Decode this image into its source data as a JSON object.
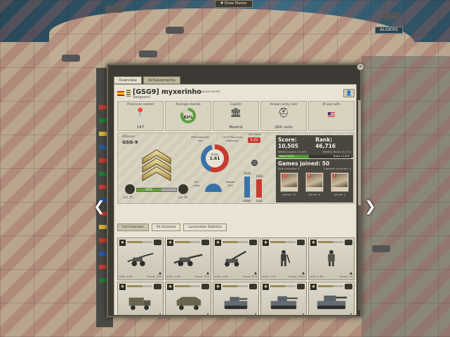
{
  "map": {
    "show_marker_label": "▼ Show Marker",
    "city_label": "ALGIERS"
  },
  "dialog": {
    "tabs": [
      "Overview",
      "Achievements"
    ],
    "close_icon": "×",
    "profile_icon": "person-icon"
  },
  "player": {
    "name": "[GSG9] myxerinho",
    "status": "(pause level)",
    "rank_title": "Sergeant"
  },
  "stats": [
    {
      "label": "Provinces owned",
      "value": "147",
      "icon": "pin-icon"
    },
    {
      "label": "Average morale",
      "value": "82%",
      "icon": "morale-ring"
    },
    {
      "label": "Capital",
      "value": "Madrid",
      "icon": "capitol-icon"
    },
    {
      "label": "Known army size",
      "value": "264 units",
      "icon": "helmet-icon"
    },
    {
      "label": "At war with",
      "value": "",
      "icon": "flag-us-icon"
    }
  ],
  "alliance": {
    "label": "Alliance",
    "name": "GSG-9"
  },
  "rank": {
    "xp_percent_label": "60%",
    "level_left": "Lvl. 41",
    "level_right": "Lvl. 42"
  },
  "combat": {
    "ratio_label": "Ratio",
    "ratio_value": "1.61",
    "provinces_lost_label": "398 Provinces lost",
    "provinces_captured_label": "1037 Provinces captured",
    "kd_label": "K/D Ratio",
    "kd_value": "1.22",
    "left_caption": "NO\nstats",
    "right_caption": "Missed\n44%",
    "bar_left_value": "1646",
    "bar_right_value": "1403",
    "bar_left_label": "Killed",
    "bar_right_label": "Lost"
  },
  "score": {
    "score_label": "Score: 10,505",
    "rank_label": "Rank: 46,716",
    "sub_left": "Weekly score: 10,505",
    "sub_right": "Weekly Rank: 91,715",
    "bar_left": "Score 3,872",
    "bar_right": "Score 11,005"
  },
  "games": {
    "title": "Games joined: 50",
    "sub_left": "Solo victories: 0",
    "sub_right": "Coalition victories: 3",
    "cards": [
      {
        "count": "13",
        "label": "Joined: 13"
      },
      {
        "count": "0",
        "label": "Joined: 0"
      },
      {
        "count": "2",
        "label": "Joined: 2"
      }
    ]
  },
  "filters": [
    "Full Extended",
    "All Unlocked",
    "Locomotion Statistics"
  ],
  "units": [
    {
      "name": "anti-tank-gun",
      "kills": "Kills: 3.92",
      "score": "Score: 382"
    },
    {
      "name": "artillery",
      "kills": "Kills: 2.09",
      "score": "Score: 319"
    },
    {
      "name": "anti-air-gun",
      "kills": "Kills: 4.49",
      "score": "Score: 673"
    },
    {
      "name": "infantry-rifleman",
      "kills": "Kills: 1.31",
      "score": "Score: 1000"
    },
    {
      "name": "infantry-officer",
      "kills": "Kills: 0.83",
      "score": "Score: 79"
    },
    {
      "name": "truck",
      "kills": "Kills: 0",
      "score": "Score: 86"
    },
    {
      "name": "armored-car",
      "kills": "Kills: 0.74",
      "score": "Score: 0"
    },
    {
      "name": "light-tank",
      "kills": "Kills: 2.38",
      "score": "Score: 1133"
    },
    {
      "name": "medium-tank",
      "kills": "Kills: 3.74",
      "score": "Score: 3000"
    },
    {
      "name": "heavy-tank",
      "kills": "Kills: 11",
      "score": "Score: 100"
    }
  ],
  "colors": {
    "accent_red": "#c73b30",
    "accent_blue": "#3a72a8",
    "accent_green": "#5ea434"
  }
}
